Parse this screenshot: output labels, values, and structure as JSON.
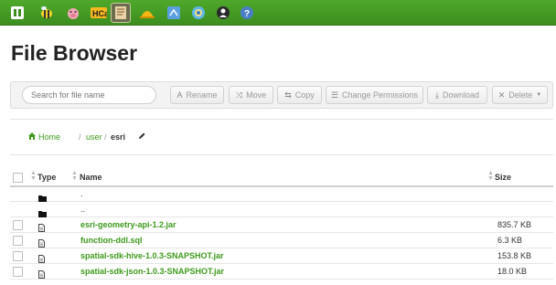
{
  "app_icons": [
    {
      "name": "hue-home-icon",
      "color": "#ffffff",
      "active": false
    },
    {
      "name": "hive-bee-icon",
      "color": "#f5d327",
      "active": false
    },
    {
      "name": "pig-icon",
      "color": "#f4a6b8",
      "active": false
    },
    {
      "name": "hcat-icon",
      "color": "#f6b81f",
      "active": false
    },
    {
      "name": "file-browser-icon",
      "color": "#e9d2a8",
      "active": true
    },
    {
      "name": "job-designer-icon",
      "color": "#f8b514",
      "active": false
    },
    {
      "name": "job-browser-icon",
      "color": "#5aa0e0",
      "active": false
    },
    {
      "name": "oozie-icon",
      "color": "#5eb7e8",
      "active": false
    },
    {
      "name": "user-admin-icon",
      "color": "#2a2a2a",
      "active": false
    },
    {
      "name": "help-icon",
      "color": "#4a7fc8",
      "active": false
    }
  ],
  "page": {
    "title": "File Browser"
  },
  "search": {
    "placeholder": "Search for file name"
  },
  "toolbar": {
    "rename": "Rename",
    "move": "Move",
    "copy": "Copy",
    "change_permissions": "Change Permissions",
    "download": "Download",
    "delete": "Delete"
  },
  "breadcrumb": {
    "home": "Home",
    "sep1": "/",
    "user": "user",
    "sep2": "/",
    "current": "esri"
  },
  "table": {
    "headers": {
      "type": "Type",
      "name": "Name",
      "size": "Size"
    },
    "rows": [
      {
        "type": "folder",
        "name": ".",
        "size": ""
      },
      {
        "type": "folder",
        "name": "..",
        "size": ""
      },
      {
        "type": "file",
        "name": "esri-geometry-api-1.2.jar",
        "size": "835.7 KB"
      },
      {
        "type": "file",
        "name": "function-ddl.sql",
        "size": "6.3 KB"
      },
      {
        "type": "file",
        "name": "spatial-sdk-hive-1.0.3-SNAPSHOT.jar",
        "size": "153.8 KB"
      },
      {
        "type": "file",
        "name": "spatial-sdk-json-1.0.3-SNAPSHOT.jar",
        "size": "18.0 KB"
      }
    ]
  },
  "colors": {
    "brand_green": "#3f9a1c",
    "topbar": "#4fa82b"
  }
}
